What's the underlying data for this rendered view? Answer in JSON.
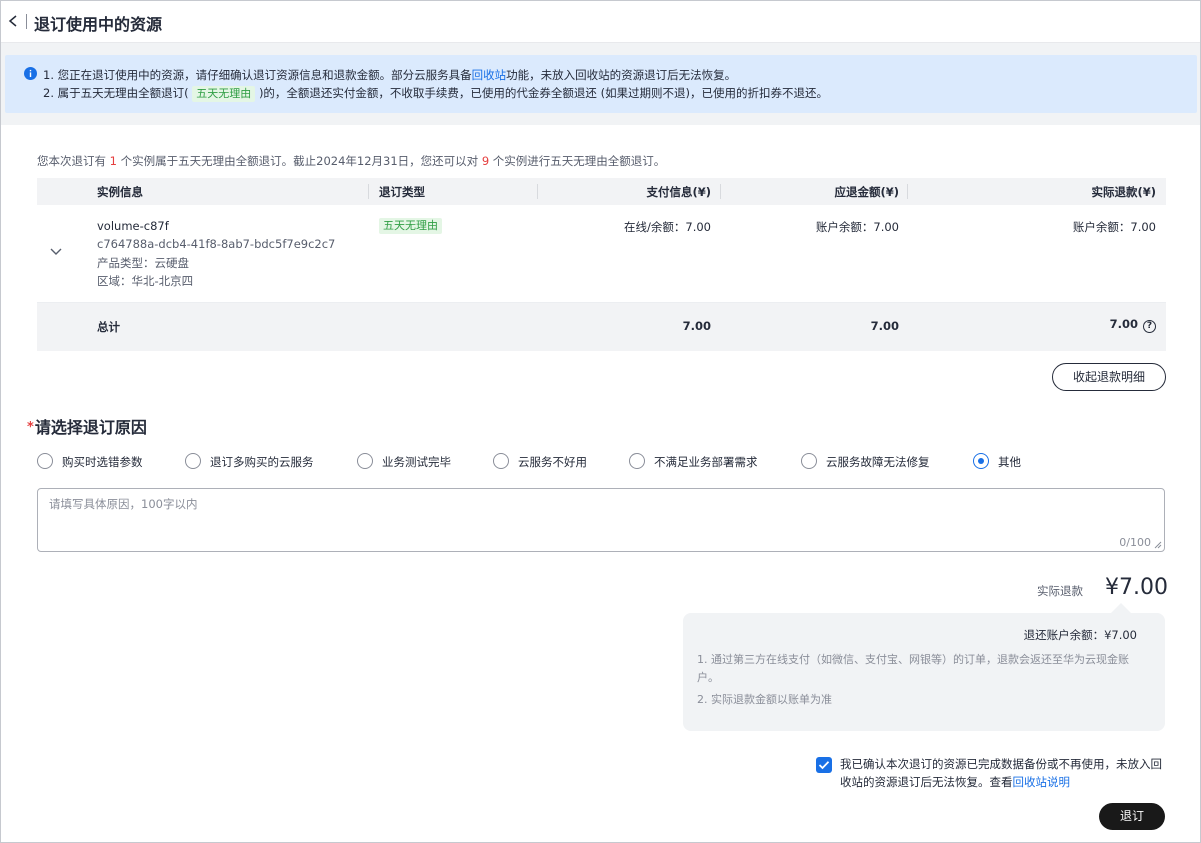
{
  "header": {
    "title": "退订使用中的资源"
  },
  "notice": {
    "line1_prefix": "1. 您正在退订使用中的资源，请仔细确认退订资源信息和退款金额。部分云服务具备",
    "line1_link": "回收站",
    "line1_suffix": "功能，未放入回收站的资源退订后无法恢复。",
    "line2_prefix": "2. 属于五天无理由全额退订(",
    "line2_tag": "五天无理由",
    "line2_suffix": ")的，全额退还实付金额，不收取手续费，已使用的代金券全额退还 (如果过期则不退)，已使用的折扣券不退还。"
  },
  "summary": {
    "part1": "您本次退订有 ",
    "count1": "1",
    "part2": " 个实例属于五天无理由全额退订。截止2024年12月31日，您还可以对 ",
    "count2": "9",
    "part3": " 个实例进行五天无理由全额退订。"
  },
  "table": {
    "headers": {
      "instance": "实例信息",
      "type": "退订类型",
      "payment": "支付信息(¥)",
      "due": "应退金额(¥)",
      "actual": "实际退款(¥)"
    },
    "row": {
      "name": "volume-c87f",
      "id": "c764788a-dcb4-41f8-8ab7-bdc5f7e9c2c7",
      "product_type": "产品类型：云硬盘",
      "region": "区域：华北-北京四",
      "type_tag": "五天无理由",
      "payment": "在线/余额：7.00",
      "due": "账户余额：7.00",
      "actual": "账户余额：7.00"
    },
    "total": {
      "label": "总计",
      "payment": "7.00",
      "due": "7.00",
      "actual": "7.00"
    }
  },
  "collapse_button": "收起退款明细",
  "reason": {
    "title": "请选择退订原因",
    "required_mark": "*",
    "options": [
      "购买时选错参数",
      "退订多购买的云服务",
      "业务测试完毕",
      "云服务不好用",
      "不满足业务部署需求",
      "云服务故障无法修复",
      "其他"
    ],
    "selected": "其他",
    "textarea_placeholder": "请填写具体原因，100字以内",
    "counter": "0/100"
  },
  "refund": {
    "label": "实际退款",
    "amount": "¥7.00",
    "account_line": "退还账户余额：¥7.00",
    "note1": "1. 通过第三方在线支付（如微信、支付宝、网银等）的订单，退款会返还至华为云现金账户。",
    "note2": "2. 实际退款金额以账单为准"
  },
  "confirm": {
    "checked": true,
    "text": "我已确认本次退订的资源已完成数据备份或不再使用，未放入回收站的资源退订后无法恢复。查看",
    "link": "回收站说明"
  },
  "submit_button": "退订",
  "colors": {
    "link": "#1970e6",
    "accent_red": "#e53e3e",
    "tag_green": "#2f9e44",
    "notice_bg": "#dbeafd"
  }
}
